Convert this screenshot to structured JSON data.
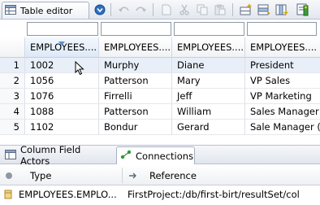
{
  "toolbar": {
    "title": "Table editor",
    "icons": [
      "table-icon",
      "dropdown-circle-icon",
      "undo-icon",
      "redo-icon",
      "new-document-icon",
      "cut-icon",
      "copy-icon",
      "paste-icon",
      "add-row-icon",
      "insert-row-icon",
      "add-column-icon",
      "edit-icon"
    ]
  },
  "filters": [
    "",
    "",
    "",
    ""
  ],
  "table": {
    "columns": [
      "EMPLOYEES....",
      "EMPLOYEES....",
      "EMPLOYEES....",
      "EMPLOYEES...."
    ],
    "rows": [
      {
        "num": "1",
        "cells": [
          "1002",
          "Murphy",
          "Diane",
          "President"
        ]
      },
      {
        "num": "2",
        "cells": [
          "1056",
          "Patterson",
          "Mary",
          "VP Sales"
        ]
      },
      {
        "num": "3",
        "cells": [
          "1076",
          "Firrelli",
          "Jeff",
          "VP Marketing"
        ]
      },
      {
        "num": "4",
        "cells": [
          "1088",
          "Patterson",
          "William",
          "Sales Manager"
        ]
      },
      {
        "num": "5",
        "cells": [
          "1102",
          "Bondur",
          "Gerard",
          "Sale Manager ("
        ]
      }
    ]
  },
  "views": {
    "tabs": [
      {
        "label": "Column Field Actors"
      },
      {
        "label": "Connections"
      }
    ]
  },
  "connections": {
    "headers": {
      "type": "Type",
      "reference": "Reference"
    },
    "rows": [
      {
        "type": "EMPLOYEES.EMPLO...",
        "reference": "FirstProject:/db/first-birt/resultSet/col"
      }
    ]
  },
  "colors": {
    "accent": "#2f6fbf",
    "selection": "#e9eff8",
    "green": "#2e9b3a"
  }
}
